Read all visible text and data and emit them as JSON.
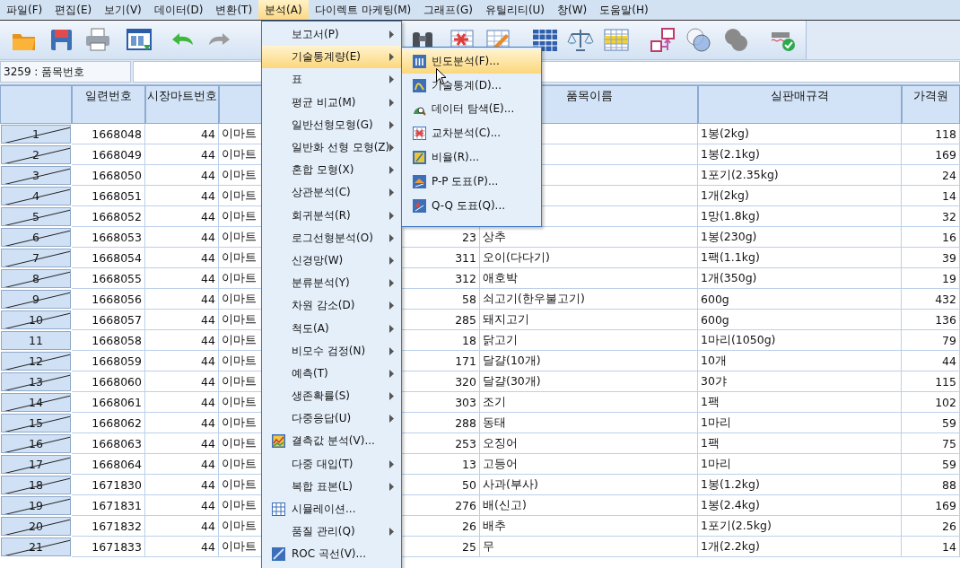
{
  "menubar": [
    {
      "label": "파일(F)",
      "selected": false
    },
    {
      "label": "편집(E)",
      "selected": false
    },
    {
      "label": "보기(V)",
      "selected": false
    },
    {
      "label": "데이터(D)",
      "selected": false
    },
    {
      "label": "변환(T)",
      "selected": false
    },
    {
      "label": "분석(A)",
      "selected": true
    },
    {
      "label": "다이렉트 마케팅(M)",
      "selected": false
    },
    {
      "label": "그래프(G)",
      "selected": false
    },
    {
      "label": "유틸리티(U)",
      "selected": false
    },
    {
      "label": "창(W)",
      "selected": false
    },
    {
      "label": "도움말(H)",
      "selected": false
    }
  ],
  "cell_bar": {
    "reference": "3259 : 품목번호"
  },
  "table": {
    "headers": [
      "일련번호",
      "시장마트번호",
      "품목이름",
      "실판매규격",
      "가격원"
    ],
    "rows": [
      {
        "number": "1",
        "filtered": true,
        "serial": "1668048",
        "market_no": "44",
        "column_3": "이마트",
        "spec": "1봉(2kg)",
        "price": "118"
      },
      {
        "number": "2",
        "filtered": true,
        "serial": "1668049",
        "market_no": "44",
        "column_3": "이마트",
        "spec": "1봉(2.1kg)",
        "price": "169"
      },
      {
        "number": "3",
        "filtered": true,
        "serial": "1668050",
        "market_no": "44",
        "column_3": "이마트",
        "spec": "1포기(2.35kg)",
        "price": "24"
      },
      {
        "number": "4",
        "filtered": true,
        "serial": "1668051",
        "market_no": "44",
        "column_3": "이마트",
        "spec": "1개(2kg)",
        "price": "14"
      },
      {
        "number": "5",
        "filtered": true,
        "serial": "1668052",
        "market_no": "44",
        "column_3": "이마트",
        "spec": "1망(1.8kg)",
        "price": "32"
      },
      {
        "number": "6",
        "filtered": true,
        "serial": "1668053",
        "market_no": "44",
        "column_3": "이마트",
        "column_4": "23",
        "item_name": "상추",
        "spec": "1봉(230g)",
        "price": "16"
      },
      {
        "number": "7",
        "filtered": true,
        "serial": "1668054",
        "market_no": "44",
        "column_3": "이마트",
        "column_4": "311",
        "item_name": "오이(다다기)",
        "spec": "1팩(1.1kg)",
        "price": "39"
      },
      {
        "number": "8",
        "filtered": true,
        "serial": "1668055",
        "market_no": "44",
        "column_3": "이마트",
        "column_4": "312",
        "item_name": "애호박",
        "spec": "1개(350g)",
        "price": "19"
      },
      {
        "number": "9",
        "filtered": true,
        "serial": "1668056",
        "market_no": "44",
        "column_3": "이마트",
        "column_4": "58",
        "item_name": "쇠고기(한우불고기)",
        "spec": "600g",
        "price": "432"
      },
      {
        "number": "10",
        "filtered": true,
        "serial": "1668057",
        "market_no": "44",
        "column_3": "이마트",
        "column_4": "285",
        "item_name": "돼지고기",
        "spec": "600g",
        "price": "136"
      },
      {
        "number": "11",
        "filtered": false,
        "serial": "1668058",
        "market_no": "44",
        "column_3": "이마트",
        "column_4": "18",
        "item_name": "닭고기",
        "spec": "1마리(1050g)",
        "price": "79"
      },
      {
        "number": "12",
        "filtered": true,
        "serial": "1668059",
        "market_no": "44",
        "column_3": "이마트",
        "column_4": "171",
        "item_name": "달걀(10개)",
        "spec": "10개",
        "price": "44"
      },
      {
        "number": "13",
        "filtered": true,
        "serial": "1668060",
        "market_no": "44",
        "column_3": "이마트",
        "column_4": "320",
        "item_name": "달걀(30개)",
        "spec": "30갸",
        "price": "115"
      },
      {
        "number": "14",
        "filtered": true,
        "serial": "1668061",
        "market_no": "44",
        "column_3": "이마트",
        "column_4": "303",
        "item_name": "조기",
        "spec": "1팩",
        "price": "102"
      },
      {
        "number": "15",
        "filtered": true,
        "serial": "1668062",
        "market_no": "44",
        "column_3": "이마트",
        "column_4": "288",
        "item_name": "동태",
        "spec": "1마리",
        "price": "59"
      },
      {
        "number": "16",
        "filtered": true,
        "serial": "1668063",
        "market_no": "44",
        "column_3": "이마트",
        "column_4": "253",
        "item_name": "오징어",
        "spec": "1팩",
        "price": "75"
      },
      {
        "number": "17",
        "filtered": true,
        "serial": "1668064",
        "market_no": "44",
        "column_3": "이마트",
        "column_4": "13",
        "item_name": "고등어",
        "spec": "1마리",
        "price": "59"
      },
      {
        "number": "18",
        "filtered": true,
        "serial": "1671830",
        "market_no": "44",
        "column_3": "이마트",
        "column_4": "50",
        "item_name": "사과(부사)",
        "spec": "1봉(1.2kg)",
        "price": "88"
      },
      {
        "number": "19",
        "filtered": true,
        "serial": "1671831",
        "market_no": "44",
        "column_3": "이마트",
        "column_4": "276",
        "item_name": "배(신고)",
        "spec": "1봉(2.4kg)",
        "price": "169"
      },
      {
        "number": "20",
        "filtered": true,
        "serial": "1671832",
        "market_no": "44",
        "column_3": "이마트",
        "column_4": "26",
        "item_name": "배추",
        "spec": "1포기(2.5kg)",
        "price": "26"
      },
      {
        "number": "21",
        "filtered": true,
        "serial": "1671833",
        "market_no": "44",
        "column_3": "이마트",
        "column_4": "25",
        "item_name": "무",
        "spec": "1개(2.2kg)",
        "price": "14"
      }
    ]
  },
  "dropdown": {
    "items": [
      {
        "label": "보고서(P)",
        "kind": "submenu",
        "selected": false
      },
      {
        "label": "기술통계량(E)",
        "kind": "submenu",
        "selected": true
      },
      {
        "label": "표",
        "kind": "submenu",
        "selected": false
      },
      {
        "label": "평균 비교(M)",
        "kind": "submenu",
        "selected": false
      },
      {
        "label": "일반선형모형(G)",
        "kind": "submenu",
        "selected": false
      },
      {
        "label": "일반화 선형 모형(Z)",
        "kind": "submenu",
        "selected": false
      },
      {
        "label": "혼합 모형(X)",
        "kind": "submenu",
        "selected": false
      },
      {
        "label": "상관분석(C)",
        "kind": "submenu",
        "selected": false
      },
      {
        "label": "회귀분석(R)",
        "kind": "submenu",
        "selected": false
      },
      {
        "label": "로그선형분석(O)",
        "kind": "submenu",
        "selected": false
      },
      {
        "label": "신경망(W)",
        "kind": "submenu",
        "selected": false
      },
      {
        "label": "분류분석(Y)",
        "kind": "submenu",
        "selected": false
      },
      {
        "label": "차원 감소(D)",
        "kind": "submenu",
        "selected": false
      },
      {
        "label": "척도(A)",
        "kind": "submenu",
        "selected": false
      },
      {
        "label": "비모수 검정(N)",
        "kind": "submenu",
        "selected": false
      },
      {
        "label": "예측(T)",
        "kind": "submenu",
        "selected": false
      },
      {
        "label": "생존확률(S)",
        "kind": "submenu",
        "selected": false
      },
      {
        "label": "다중응답(U)",
        "kind": "submenu",
        "selected": false
      },
      {
        "label": "결측값 분석(V)...",
        "kind": "action",
        "selected": false
      },
      {
        "label": "다중 대입(T)",
        "kind": "submenu",
        "selected": false
      },
      {
        "label": "복합 표본(L)",
        "kind": "submenu",
        "selected": false
      },
      {
        "label": "시뮬레이션...",
        "kind": "action",
        "selected": false
      },
      {
        "label": "품질 관리(Q)",
        "kind": "submenu",
        "selected": false
      },
      {
        "label": "ROC 곡선(V)...",
        "kind": "action",
        "selected": false
      }
    ]
  },
  "submenu": {
    "items": [
      {
        "label": "빈도분석(F)...",
        "kind": "action",
        "selected": true
      },
      {
        "label": "기술통계(D)...",
        "kind": "action",
        "selected": false
      },
      {
        "label": "데이터 탐색(E)...",
        "kind": "action",
        "selected": false
      },
      {
        "label": "교차분석(C)...",
        "kind": "action",
        "selected": false
      },
      {
        "label": "비율(R)...",
        "kind": "action",
        "selected": false
      },
      {
        "label": "P-P 도표(P)...",
        "kind": "action",
        "selected": false
      },
      {
        "label": "Q-Q 도표(Q)...",
        "kind": "action",
        "selected": false
      }
    ]
  }
}
